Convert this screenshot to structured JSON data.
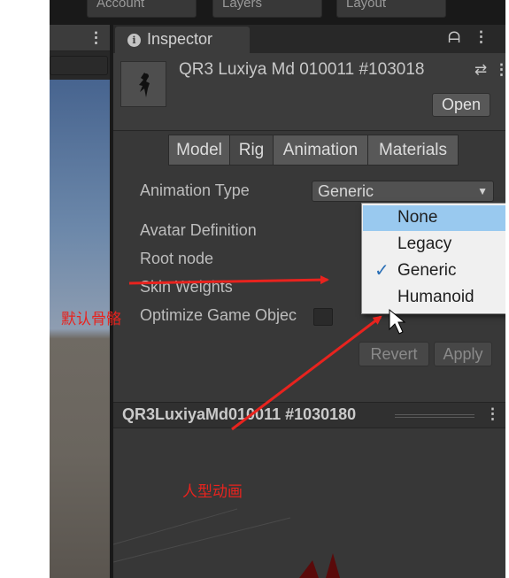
{
  "toolbar": {
    "account_label": "Account",
    "layers_label": "Layers",
    "layout_label": "Layout"
  },
  "scene_panel": {
    "menu_glyph": "⋮"
  },
  "inspector": {
    "tab_title": "Inspector",
    "menu_glyph": "⋮",
    "lock_glyph": "ᗩ"
  },
  "asset": {
    "name": "QR3 Luxiya Md 010011 #103018",
    "open_label": "Open",
    "settings_glyph": "⇄",
    "menu_glyph": "⋮"
  },
  "tabs": [
    {
      "label": "Model",
      "active": false
    },
    {
      "label": "Rig",
      "active": true
    },
    {
      "label": "Animation",
      "active": false
    },
    {
      "label": "Materials",
      "active": false
    }
  ],
  "rig": {
    "animation_type_label": "Animation Type",
    "animation_type_value": "Generic",
    "avatar_definition_label": "Avatar Definition",
    "root_node_label": "Root node",
    "skin_weights_label": "Skin Weights",
    "optimize_label": "Optimize Game Objec",
    "revert_label": "Revert",
    "apply_label": "Apply"
  },
  "dropdown": {
    "options": [
      {
        "label": "None",
        "highlighted": true,
        "checked": false
      },
      {
        "label": "Legacy",
        "highlighted": false,
        "checked": false
      },
      {
        "label": "Generic",
        "highlighted": false,
        "checked": true
      },
      {
        "label": "Humanoid",
        "highlighted": false,
        "checked": false
      }
    ],
    "check_glyph": "✓"
  },
  "preview": {
    "title": "QR3LuxiyaMd010011 #1030180",
    "menu_glyph": "⋮"
  },
  "annotations": {
    "default_skeleton": "默认骨骼",
    "humanoid_animation": "人型动画"
  },
  "colors": {
    "annotation_red": "#e8231e",
    "dropdown_highlight": "#99c9ef",
    "panel_bg": "#383838"
  }
}
